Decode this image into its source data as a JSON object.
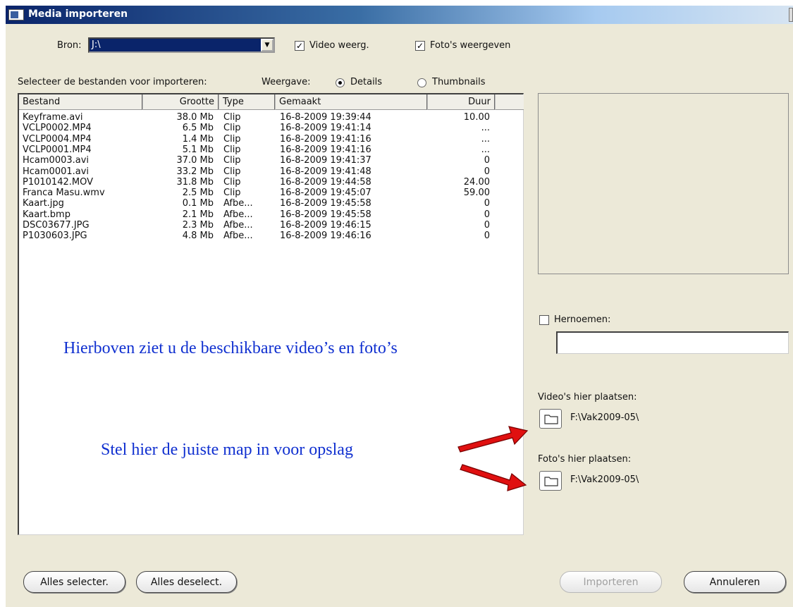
{
  "window": {
    "title": "Media importeren"
  },
  "source": {
    "label": "Bron:",
    "value": "J:\\"
  },
  "options": {
    "video_label": "Video weerg.",
    "photo_label": "Foto's weergeven"
  },
  "list_label": "Selecteer de bestanden voor importeren:",
  "view": {
    "label": "Weergave:",
    "details": "Details",
    "thumbnails": "Thumbnails",
    "selected": "Details"
  },
  "columns": [
    "Bestand",
    "Grootte",
    "Type",
    "Gemaakt",
    "Duur"
  ],
  "files": [
    {
      "name": "Keyframe.avi",
      "size": "38.0 Mb",
      "type": "Clip",
      "created": "16-8-2009 19:39:44",
      "duration": "10.00"
    },
    {
      "name": "VCLP0002.MP4",
      "size": "6.5 Mb",
      "type": "Clip",
      "created": "16-8-2009 19:41:14",
      "duration": "..."
    },
    {
      "name": "VCLP0004.MP4",
      "size": "1.4 Mb",
      "type": "Clip",
      "created": "16-8-2009 19:41:16",
      "duration": "..."
    },
    {
      "name": "VCLP0001.MP4",
      "size": "5.1 Mb",
      "type": "Clip",
      "created": "16-8-2009 19:41:16",
      "duration": "..."
    },
    {
      "name": "Hcam0003.avi",
      "size": "37.0 Mb",
      "type": "Clip",
      "created": "16-8-2009 19:41:37",
      "duration": "0"
    },
    {
      "name": "Hcam0001.avi",
      "size": "33.2 Mb",
      "type": "Clip",
      "created": "16-8-2009 19:41:48",
      "duration": "0"
    },
    {
      "name": "P1010142.MOV",
      "size": "31.8 Mb",
      "type": "Clip",
      "created": "16-8-2009 19:44:58",
      "duration": "24.00"
    },
    {
      "name": "Franca Masu.wmv",
      "size": "2.5 Mb",
      "type": "Clip",
      "created": "16-8-2009 19:45:07",
      "duration": "59.00"
    },
    {
      "name": "Kaart.jpg",
      "size": "0.1 Mb",
      "type": "Afbe...",
      "created": "16-8-2009 19:45:58",
      "duration": "0"
    },
    {
      "name": "Kaart.bmp",
      "size": "2.1 Mb",
      "type": "Afbe...",
      "created": "16-8-2009 19:45:58",
      "duration": "0"
    },
    {
      "name": "DSC03677.JPG",
      "size": "2.3 Mb",
      "type": "Afbe...",
      "created": "16-8-2009 19:46:15",
      "duration": "0"
    },
    {
      "name": "P1030603.JPG",
      "size": "4.8 Mb",
      "type": "Afbe...",
      "created": "16-8-2009 19:46:16",
      "duration": "0"
    }
  ],
  "rename": {
    "label": "Hernoemen:",
    "value": ""
  },
  "video_dest": {
    "label": "Video's hier plaatsen:",
    "path": "F:\\Vak2009-05\\"
  },
  "photo_dest": {
    "label": "Foto's hier plaatsen:",
    "path": "F:\\Vak2009-05\\"
  },
  "annotations": {
    "top": "Hierboven ziet u de beschikbare video’s en foto’s",
    "bottom": "Stel hier de juiste map in voor opslag"
  },
  "buttons": {
    "select_all": "Alles selecter.",
    "deselect_all": "Alles deselect.",
    "import": "Importeren",
    "cancel": "Annuleren"
  },
  "colors": {
    "annotation": "#1030d0",
    "arrow": "#e01010",
    "titlebar": "#0a246a"
  }
}
